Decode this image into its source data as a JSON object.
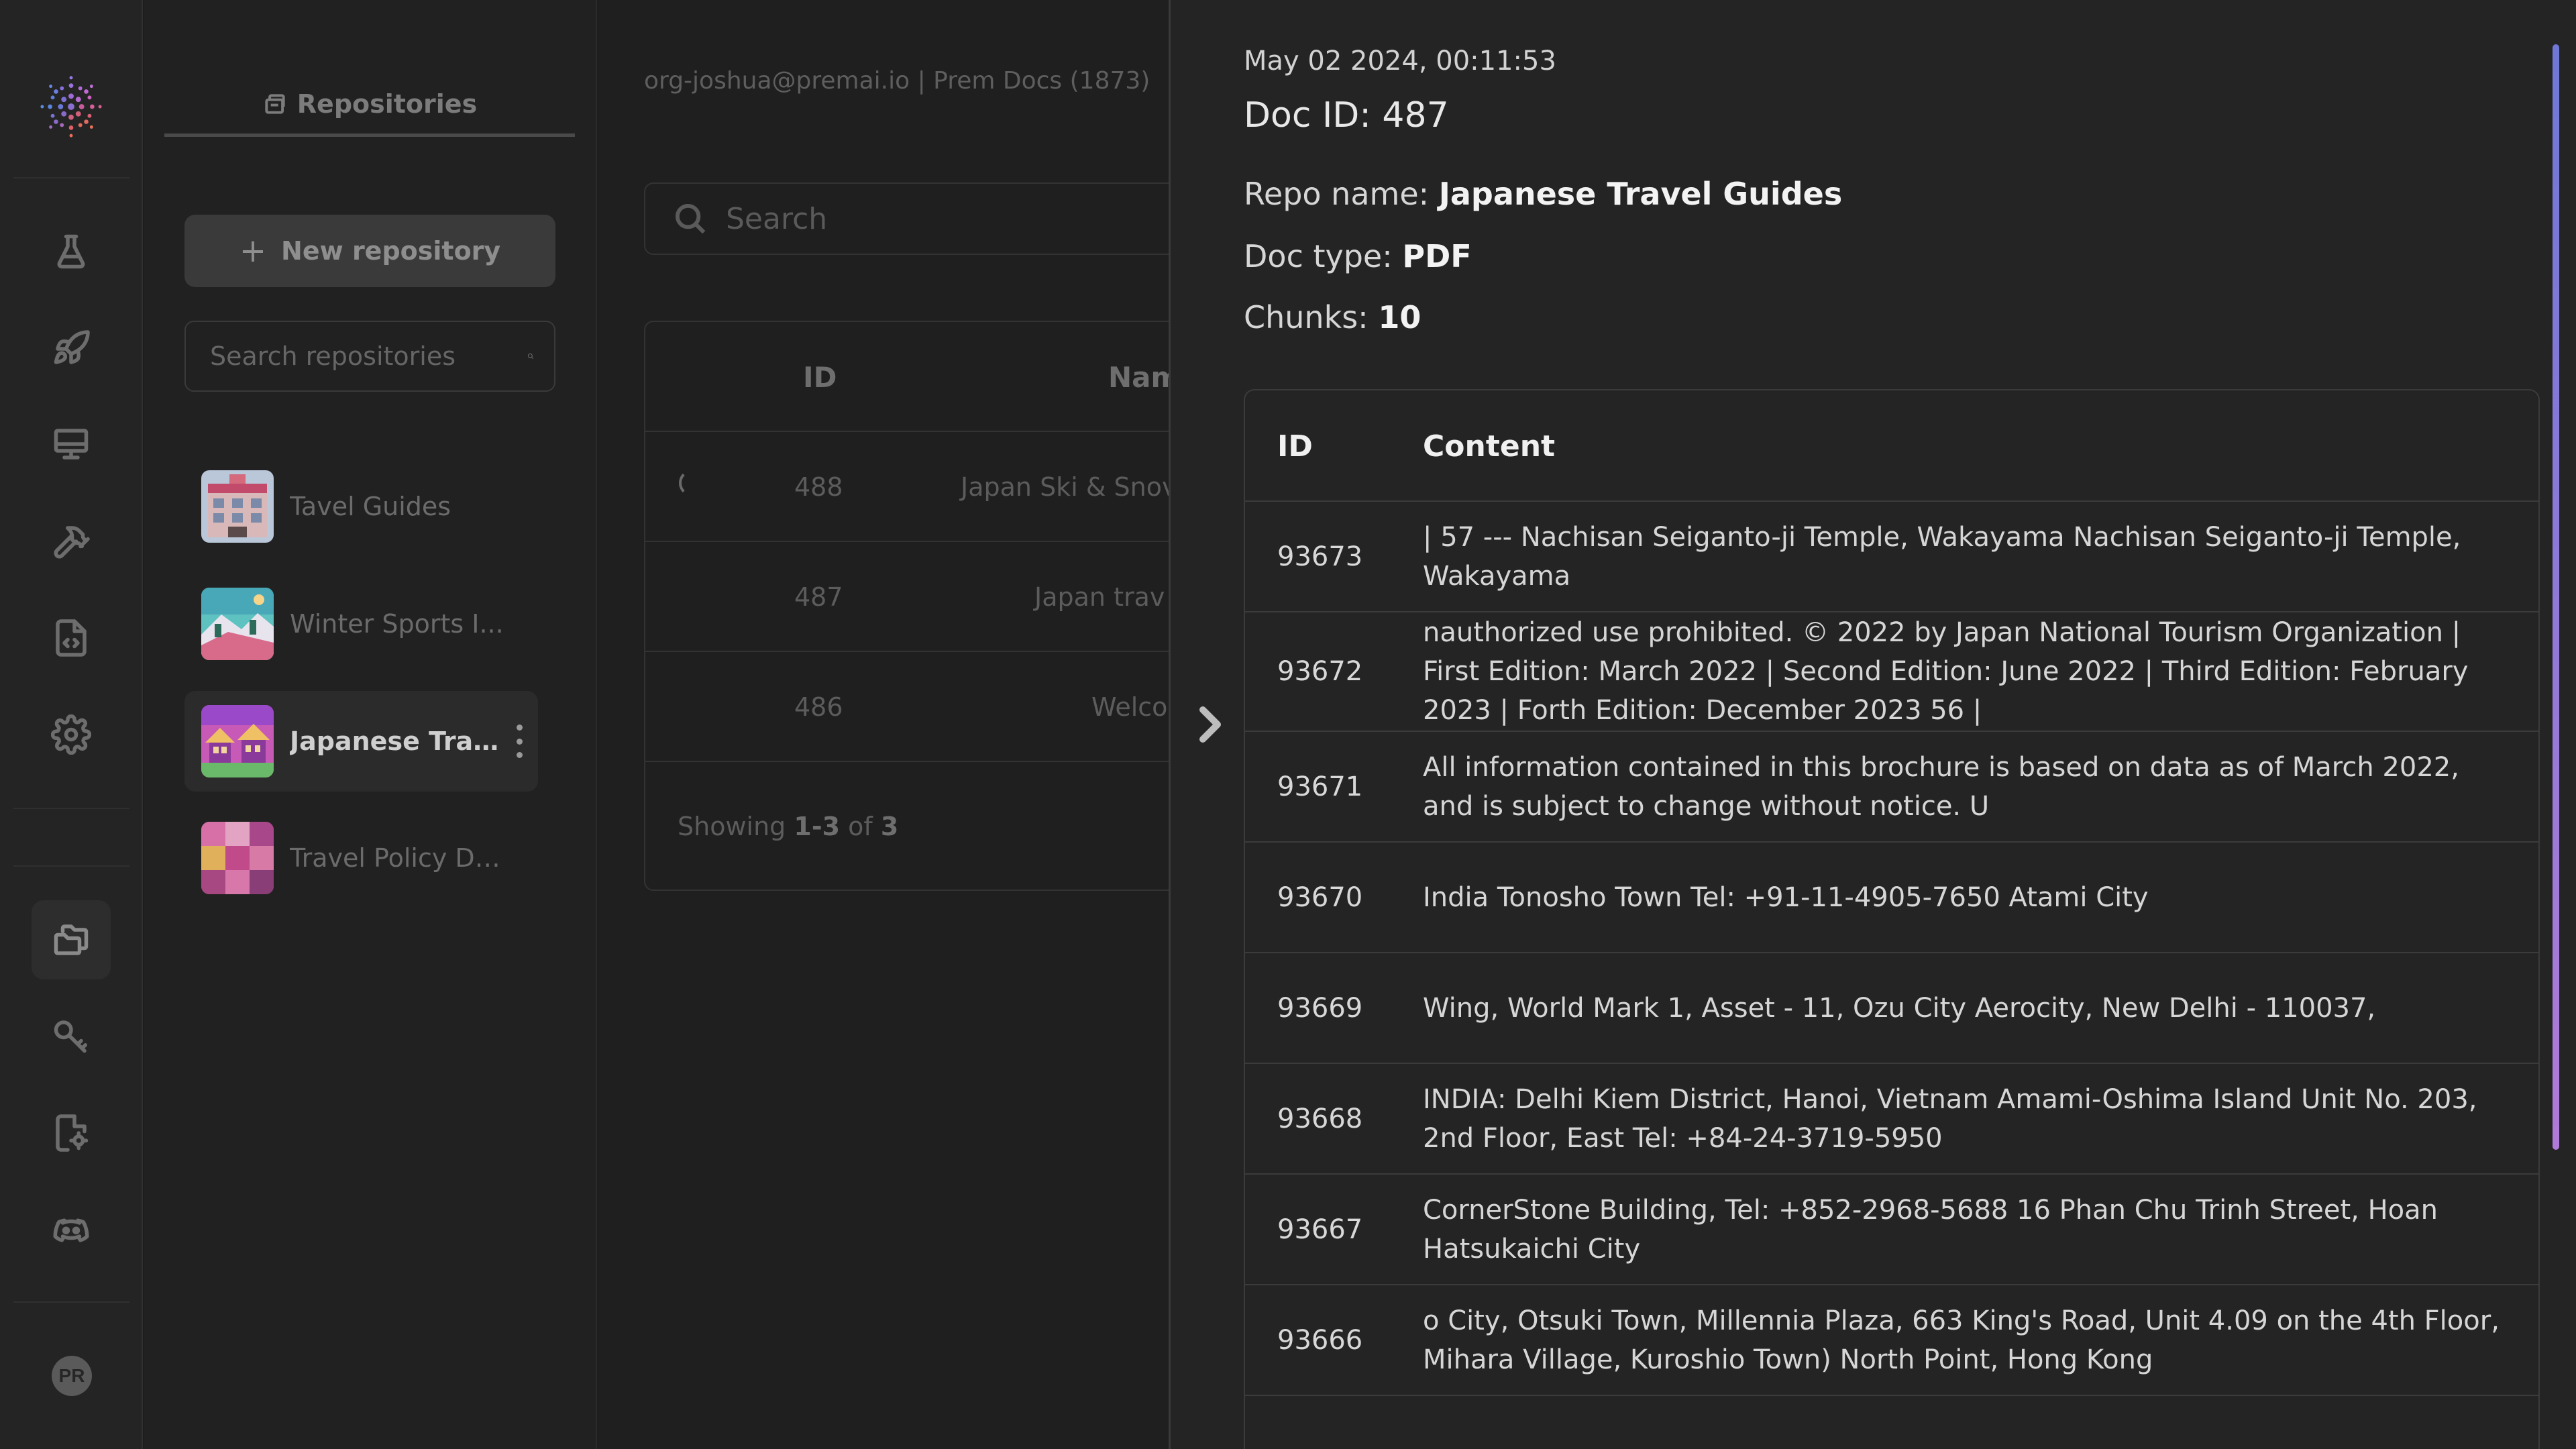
{
  "rail": {
    "icons": [
      "experiment-flask-icon",
      "rocket-icon",
      "monitor-icon",
      "hammer-icon",
      "code-file-icon",
      "settings-gear-icon",
      "repositories-folder-icon",
      "key-icon",
      "document-settings-icon",
      "discord-icon"
    ],
    "active": "repositories-folder-icon",
    "avatar_initials": "PR"
  },
  "repos_panel": {
    "tab_label": "Repositories",
    "new_button_label": "New repository",
    "search_placeholder": "Search repositories",
    "items": [
      {
        "name": "Tavel Guides",
        "active": false
      },
      {
        "name": "Winter Sports I...",
        "active": false
      },
      {
        "name": "Japanese Trave...",
        "active": true
      },
      {
        "name": "Travel Policy Do...",
        "active": false
      }
    ]
  },
  "main": {
    "breadcrumb": "org-joshua@premai.io | Prem Docs (1873)",
    "search_placeholder": "Search",
    "table": {
      "columns": [
        "ID",
        "Nam"
      ],
      "rows": [
        {
          "id": "488",
          "name": "Japan Ski & Snov"
        },
        {
          "id": "487",
          "name": "Japan trav"
        },
        {
          "id": "486",
          "name": "Welco"
        }
      ],
      "footer_prefix": "Showing ",
      "footer_range": "1-3",
      "footer_mid": " of ",
      "footer_total": "3"
    }
  },
  "drawer": {
    "timestamp": "May 02 2024, 00:11:53",
    "doc_id_label": "Doc ID: 487",
    "repo_name_label": "Repo name: ",
    "repo_name": "Japanese Travel Guides",
    "doc_type_label": "Doc type: ",
    "doc_type": "PDF",
    "chunks_label": "Chunks: ",
    "chunks": "10",
    "table": {
      "headers": {
        "id": "ID",
        "content": "Content"
      },
      "rows": [
        {
          "id": "93673",
          "content": "| 57 --- Nachisan Seiganto-ji Temple, Wakayama Nachisan Seiganto-ji Temple, Wakayama"
        },
        {
          "id": "93672",
          "content": "nauthorized use prohibited. © 2022 by Japan National Tourism Organization | First Edition: March 2022 | Second Edition: June 2022 | Third Edition: February 2023 | Forth Edition: December 2023 56 |"
        },
        {
          "id": "93671",
          "content": "All information contained in this brochure is based on data as of March 2022, and is subject to change without notice. U"
        },
        {
          "id": "93670",
          "content": "India Tonosho Town Tel: +91-11-4905-7650 Atami City"
        },
        {
          "id": "93669",
          "content": "Wing, World Mark 1, Asset - 11, Ozu City Aerocity, New Delhi - 110037,"
        },
        {
          "id": "93668",
          "content": "INDIA: Delhi Kiem District, Hanoi, Vietnam Amami-Oshima Island Unit No. 203, 2nd Floor, East Tel: +84-24-3719-5950"
        },
        {
          "id": "93667",
          "content": "CornerStone Building, Tel: +852-2968-5688 16 Phan Chu Trinh Street, Hoan Hatsukaichi City"
        },
        {
          "id": "93666",
          "content": "o City, Otsuki Town, Millennia Plaza, 663 King's Road, Unit 4.09 on the 4th Floor, Mihara Village, Kuroshio Town) North Point, Hong Kong"
        }
      ]
    }
  }
}
